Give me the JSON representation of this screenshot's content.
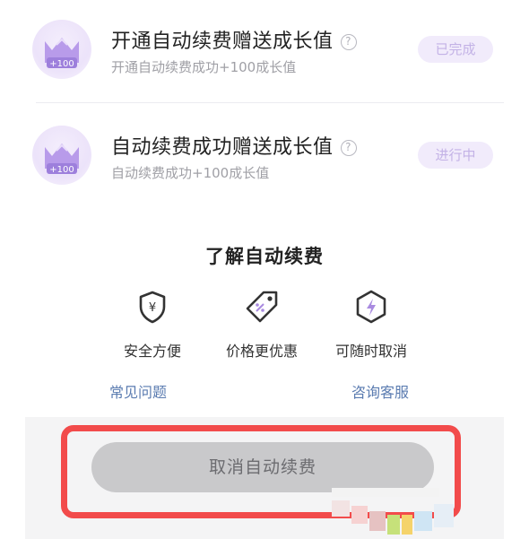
{
  "tasks": [
    {
      "title": "开通自动续费赠送成长值",
      "subtitle": "开通自动续费成功+100成长值",
      "status": "已完成",
      "badge_text": "+100",
      "help_glyph": "?"
    },
    {
      "title": "自动续费成功赠送成长值",
      "subtitle": "自动续费成功+100成长值",
      "status": "进行中",
      "badge_text": "+100",
      "help_glyph": "?"
    }
  ],
  "info": {
    "title": "了解自动续费",
    "features": [
      {
        "label": "安全方便",
        "icon": "shield-yen-icon",
        "glyph": "¥"
      },
      {
        "label": "价格更优惠",
        "icon": "price-tag-icon"
      },
      {
        "label": "可随时取消",
        "icon": "lightning-hexagon-icon"
      }
    ],
    "links": {
      "faq": "常见问题",
      "service": "咨询客服"
    }
  },
  "action": {
    "cancel_label": "取消自动续费"
  },
  "colors": {
    "accent_purple": "#a98be0",
    "status_text": "#c3b2e6",
    "link_blue": "#5a7bb0",
    "highlight_red": "#f24b4b"
  }
}
